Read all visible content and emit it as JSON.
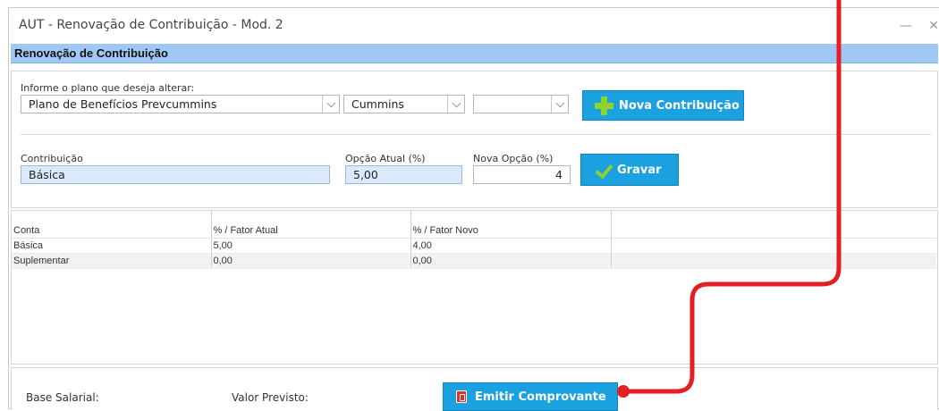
{
  "window": {
    "title": "AUT - Renovação de Contribuição - Mod. 2",
    "controls": [
      "minimize-icon",
      "close-icon"
    ]
  },
  "form": {
    "header": "Renovação de Contribuição",
    "plano": {
      "label": "Informe o plano que deseja alterar:",
      "plano_value": "Plano de Benefícios Prevcummins",
      "empresa_value": "Cummins",
      "third_value": ""
    },
    "nova_contribuicao_button": "Nova Contribuição",
    "contribuicao": {
      "label": "Contribuição",
      "value": "Básica"
    },
    "opcao_atual": {
      "label": "Opção Atual (%)",
      "value": "5,00"
    },
    "nova_opcao": {
      "label": "Nova Opção (%)",
      "value": "4"
    },
    "gravar_button": "Gravar"
  },
  "table": {
    "columns": [
      "Conta",
      "% / Fator Atual",
      "% / Fator Novo",
      ""
    ],
    "rows": [
      [
        "Básica",
        "5,00",
        "4,00",
        ""
      ],
      [
        "Suplementar",
        "0,00",
        "0,00",
        ""
      ]
    ]
  },
  "footer": {
    "base_salarial_label": "Base Salarial:",
    "valor_previsto_label": "Valor Previsto:",
    "emitir_button": "Emitir Comprovante"
  },
  "colors": {
    "header_bar": "#9fc8f5",
    "button": "#1ba1df",
    "field_highlight": "#dbeafa",
    "annotation": "#e31e24"
  }
}
